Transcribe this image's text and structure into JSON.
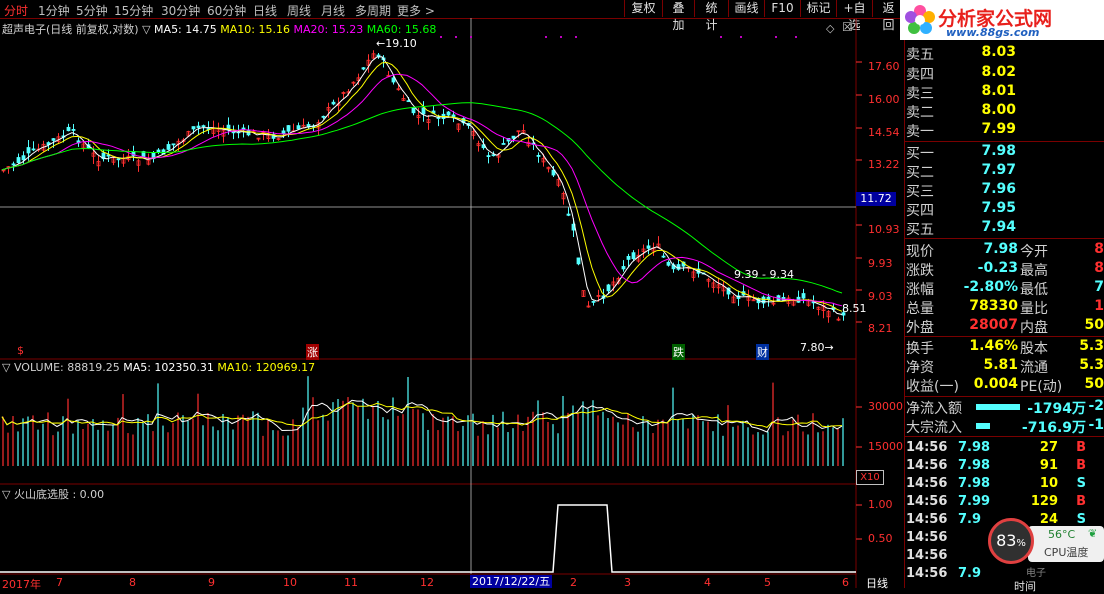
{
  "toolbar": {
    "periods": [
      "分时",
      "1分钟",
      "5分钟",
      "15分钟",
      "30分钟",
      "60分钟",
      "日线",
      "周线",
      "月线",
      "多周期",
      "更多 >"
    ],
    "buttons": [
      "复权",
      "叠加",
      "统计",
      "画线",
      "F10",
      "标记",
      "+自选",
      "返回"
    ]
  },
  "logo": {
    "title": "分析家公式网",
    "url": "www.88gs.com"
  },
  "main_chart": {
    "title": "超声电子(日线 前复权,对数) ▽",
    "ma5": "MA5: 14.75",
    "ma10": "MA10: 15.16",
    "ma20": "MA20: 15.23",
    "ma60": "MA60: 15.68",
    "high_marker": "19.10",
    "low_marker": "7.80",
    "price_box": "11.72",
    "range_note": "9.39 - 9.34",
    "last_marker": "8.51",
    "y_ticks": [
      "17.60",
      "16.00",
      "14.54",
      "13.22",
      "10.93",
      "9.93",
      "9.03",
      "8.21"
    ],
    "signals": [
      "$",
      "涨",
      "跌",
      "财"
    ]
  },
  "volume_chart": {
    "title": "▽ VOLUME: 88819.25",
    "ma5": "MA5: 102350.31",
    "ma10": "MA10: 120969.17",
    "y_ticks": [
      "30000",
      "15000"
    ],
    "unit": "X10"
  },
  "indicator_chart": {
    "title": "▽ 火山底选股 : 0.00",
    "y_ticks": [
      "1.00",
      "0.50"
    ]
  },
  "x_axis": {
    "labels": [
      "2017年",
      "7",
      "8",
      "9",
      "10",
      "11",
      "12",
      "2",
      "3",
      "4",
      "5",
      "6"
    ],
    "cursor_date": "2017/12/22/五",
    "period": "日线"
  },
  "quote_panel": {
    "sell": [
      {
        "label": "卖五",
        "price": "8.03"
      },
      {
        "label": "卖四",
        "price": "8.02"
      },
      {
        "label": "卖三",
        "price": "8.01"
      },
      {
        "label": "卖二",
        "price": "8.00"
      },
      {
        "label": "卖一",
        "price": "7.99"
      }
    ],
    "buy": [
      {
        "label": "买一",
        "price": "7.98"
      },
      {
        "label": "买二",
        "price": "7.97"
      },
      {
        "label": "买三",
        "price": "7.96"
      },
      {
        "label": "买四",
        "price": "7.95"
      },
      {
        "label": "买五",
        "price": "7.94"
      }
    ],
    "stats": [
      {
        "l1": "现价",
        "v1": "7.98",
        "l2": "今开",
        "v2": "8"
      },
      {
        "l1": "涨跌",
        "v1": "-0.23",
        "l2": "最高",
        "v2": "8"
      },
      {
        "l1": "涨幅",
        "v1": "-2.80%",
        "l2": "最低",
        "v2": "7"
      },
      {
        "l1": "总量",
        "v1": "78330",
        "l2": "量比",
        "v2": "1"
      },
      {
        "l1": "外盘",
        "v1": "28007",
        "l2": "内盘",
        "v2": "50"
      },
      {
        "l1": "换手",
        "v1": "1.46%",
        "l2": "股本",
        "v2": "5.3"
      },
      {
        "l1": "净资",
        "v1": "5.81",
        "l2": "流通",
        "v2": "5.3"
      },
      {
        "l1": "收益(一)",
        "v1": "0.004",
        "l2": "PE(动)",
        "v2": "50"
      }
    ],
    "flow": [
      {
        "label": "净流入额",
        "value": "-1794万",
        "extra": "-2"
      },
      {
        "label": "大宗流入",
        "value": "-716.9万",
        "extra": "-1"
      }
    ],
    "ticks": [
      {
        "time": "14:56",
        "price": "7.98",
        "vol": "27",
        "side": "B"
      },
      {
        "time": "14:56",
        "price": "7.98",
        "vol": "91",
        "side": "B"
      },
      {
        "time": "14:56",
        "price": "7.98",
        "vol": "10",
        "side": "S"
      },
      {
        "time": "14:56",
        "price": "7.99",
        "vol": "129",
        "side": "B"
      },
      {
        "time": "14:56",
        "price": "7.9",
        "vol": "24",
        "side": "S"
      },
      {
        "time": "14:56",
        "price": "",
        "vol": "",
        "side": ""
      },
      {
        "time": "14:56",
        "price": "",
        "vol": "",
        "side": ""
      },
      {
        "time": "14:56",
        "price": "7.9",
        "vol": "",
        "side": ""
      }
    ],
    "bottom_tab": "时间"
  },
  "cpu_widget": {
    "percent": "83",
    "unit": "%",
    "temp": "56°C",
    "label": "CPU温度",
    "ghost": "电子"
  },
  "colors": {
    "ma5": "#ffffff",
    "ma10": "#ffff00",
    "ma20": "#ff00ff",
    "ma60": "#00ff00",
    "up": "#ff3030",
    "down": "#54ffff",
    "border": "#7a0000"
  }
}
